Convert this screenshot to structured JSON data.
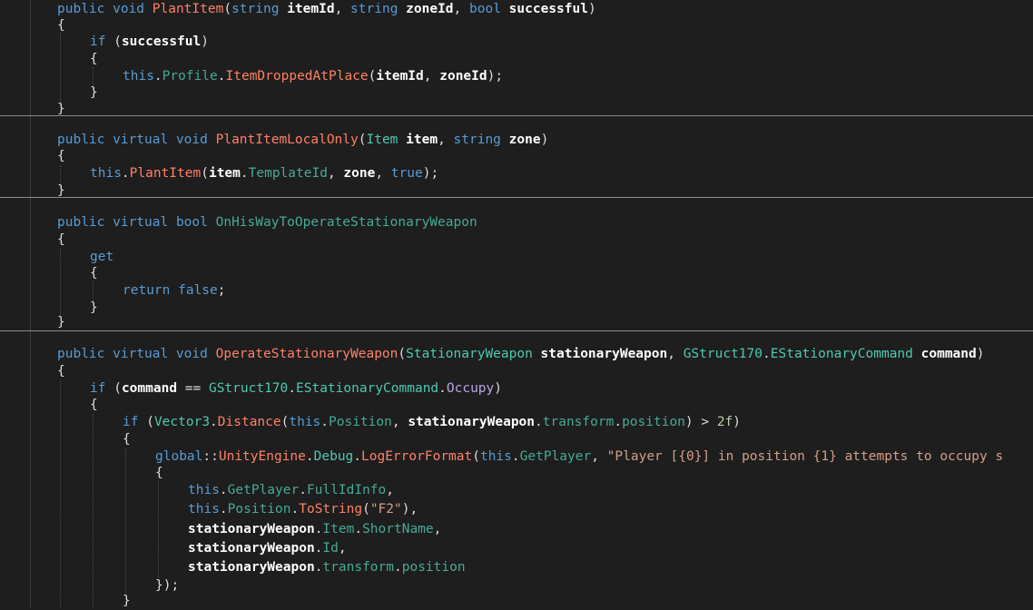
{
  "editor": {
    "theme": "dark",
    "colors": {
      "background": "#1e1e1e",
      "keyword": "#569cd6",
      "method": "#ff8066",
      "type": "#4ec9b0",
      "parameter": "#ffffff",
      "string": "#d69d85",
      "number": "#b5cea8",
      "enum_member": "#b8a7e8",
      "plain": "#dcdcdc"
    }
  },
  "lines": [
    {
      "id": "l1",
      "tokens": [
        [
          "kw",
          "public "
        ],
        [
          "kw",
          "void "
        ],
        [
          "method",
          "PlantItem"
        ],
        [
          "plain",
          "("
        ],
        [
          "kw",
          "string "
        ],
        [
          "param",
          "itemId"
        ],
        [
          "plain",
          ", "
        ],
        [
          "kw",
          "string "
        ],
        [
          "param",
          "zoneId"
        ],
        [
          "plain",
          ", "
        ],
        [
          "kw",
          "bool "
        ],
        [
          "param",
          "successful"
        ],
        [
          "plain",
          ")"
        ]
      ]
    },
    {
      "id": "l2",
      "tokens": [
        [
          "plain",
          "{"
        ]
      ]
    },
    {
      "id": "l3",
      "tokens": [
        [
          "kw",
          "if "
        ],
        [
          "plain",
          "("
        ],
        [
          "param",
          "successful"
        ],
        [
          "plain",
          ")"
        ]
      ]
    },
    {
      "id": "l4",
      "tokens": [
        [
          "plain",
          "{"
        ]
      ]
    },
    {
      "id": "l5",
      "tokens": [
        [
          "kw",
          "this"
        ],
        [
          "plain",
          "."
        ],
        [
          "prop",
          "Profile"
        ],
        [
          "plain",
          "."
        ],
        [
          "method",
          "ItemDroppedAtPlace"
        ],
        [
          "plain",
          "("
        ],
        [
          "param",
          "itemId"
        ],
        [
          "plain",
          ", "
        ],
        [
          "param",
          "zoneId"
        ],
        [
          "plain",
          ");"
        ]
      ]
    },
    {
      "id": "l6",
      "tokens": [
        [
          "plain",
          "}"
        ]
      ]
    },
    {
      "id": "l7",
      "tokens": [
        [
          "plain",
          "}"
        ]
      ]
    },
    {
      "id": "l8",
      "tokens": [
        [
          "kw",
          "public "
        ],
        [
          "kw",
          "virtual "
        ],
        [
          "kw",
          "void "
        ],
        [
          "method",
          "PlantItemLocalOnly"
        ],
        [
          "plain",
          "("
        ],
        [
          "type",
          "Item "
        ],
        [
          "param",
          "item"
        ],
        [
          "plain",
          ", "
        ],
        [
          "kw",
          "string "
        ],
        [
          "param",
          "zone"
        ],
        [
          "plain",
          ")"
        ]
      ]
    },
    {
      "id": "l9",
      "tokens": [
        [
          "plain",
          "{"
        ]
      ]
    },
    {
      "id": "l10",
      "tokens": [
        [
          "kw",
          "this"
        ],
        [
          "plain",
          "."
        ],
        [
          "method",
          "PlantItem"
        ],
        [
          "plain",
          "("
        ],
        [
          "param",
          "item"
        ],
        [
          "plain",
          "."
        ],
        [
          "prop",
          "TemplateId"
        ],
        [
          "plain",
          ", "
        ],
        [
          "param",
          "zone"
        ],
        [
          "plain",
          ", "
        ],
        [
          "kw",
          "true"
        ],
        [
          "plain",
          ");"
        ]
      ]
    },
    {
      "id": "l11",
      "tokens": [
        [
          "plain",
          "}"
        ]
      ]
    },
    {
      "id": "l12",
      "tokens": [
        [
          "kw",
          "public "
        ],
        [
          "kw",
          "virtual "
        ],
        [
          "kw",
          "bool "
        ],
        [
          "prop",
          "OnHisWayToOperateStationaryWeapon"
        ]
      ]
    },
    {
      "id": "l13",
      "tokens": [
        [
          "plain",
          "{"
        ]
      ]
    },
    {
      "id": "l14",
      "tokens": [
        [
          "kw",
          "get"
        ]
      ]
    },
    {
      "id": "l15",
      "tokens": [
        [
          "plain",
          "{"
        ]
      ]
    },
    {
      "id": "l16",
      "tokens": [
        [
          "kw",
          "return "
        ],
        [
          "kw",
          "false"
        ],
        [
          "plain",
          ";"
        ]
      ]
    },
    {
      "id": "l17",
      "tokens": [
        [
          "plain",
          "}"
        ]
      ]
    },
    {
      "id": "l18",
      "tokens": [
        [
          "plain",
          "}"
        ]
      ]
    },
    {
      "id": "l19",
      "tokens": [
        [
          "kw",
          "public "
        ],
        [
          "kw",
          "virtual "
        ],
        [
          "kw",
          "void "
        ],
        [
          "method",
          "OperateStationaryWeapon"
        ],
        [
          "plain",
          "("
        ],
        [
          "type",
          "StationaryWeapon "
        ],
        [
          "param",
          "stationaryWeapon"
        ],
        [
          "plain",
          ", "
        ],
        [
          "type",
          "GStruct170"
        ],
        [
          "plain",
          "."
        ],
        [
          "type",
          "EStationaryCommand "
        ],
        [
          "param",
          "command"
        ],
        [
          "plain",
          ")"
        ]
      ]
    },
    {
      "id": "l20",
      "tokens": [
        [
          "plain",
          "{"
        ]
      ]
    },
    {
      "id": "l21",
      "tokens": [
        [
          "kw",
          "if "
        ],
        [
          "plain",
          "("
        ],
        [
          "param",
          "command"
        ],
        [
          "plain",
          " == "
        ],
        [
          "type",
          "GStruct170"
        ],
        [
          "plain",
          "."
        ],
        [
          "type",
          "EStationaryCommand"
        ],
        [
          "plain",
          "."
        ],
        [
          "enumv",
          "Occupy"
        ],
        [
          "plain",
          ")"
        ]
      ]
    },
    {
      "id": "l22",
      "tokens": [
        [
          "plain",
          "{"
        ]
      ]
    },
    {
      "id": "l23",
      "tokens": [
        [
          "kw",
          "if "
        ],
        [
          "plain",
          "("
        ],
        [
          "type",
          "Vector3"
        ],
        [
          "plain",
          "."
        ],
        [
          "method",
          "Distance"
        ],
        [
          "plain",
          "("
        ],
        [
          "kw",
          "this"
        ],
        [
          "plain",
          "."
        ],
        [
          "prop",
          "Position"
        ],
        [
          "plain",
          ", "
        ],
        [
          "param",
          "stationaryWeapon"
        ],
        [
          "plain",
          "."
        ],
        [
          "prop",
          "transform"
        ],
        [
          "plain",
          "."
        ],
        [
          "prop",
          "position"
        ],
        [
          "plain",
          ") > "
        ],
        [
          "num",
          "2f"
        ],
        [
          "plain",
          ")"
        ]
      ]
    },
    {
      "id": "l24",
      "tokens": [
        [
          "plain",
          "{"
        ]
      ]
    },
    {
      "id": "l25",
      "tokens": [
        [
          "kw",
          "global"
        ],
        [
          "plain",
          "::"
        ],
        [
          "method",
          "UnityEngine"
        ],
        [
          "plain",
          "."
        ],
        [
          "type",
          "Debug"
        ],
        [
          "plain",
          "."
        ],
        [
          "method",
          "LogErrorFormat"
        ],
        [
          "plain",
          "("
        ],
        [
          "kw",
          "this"
        ],
        [
          "plain",
          "."
        ],
        [
          "prop",
          "GetPlayer"
        ],
        [
          "plain",
          ", "
        ],
        [
          "str",
          "\"Player [{0}] in position {1} attempts to occupy s"
        ]
      ]
    },
    {
      "id": "l26",
      "tokens": [
        [
          "plain",
          "{"
        ]
      ]
    },
    {
      "id": "l27",
      "tokens": [
        [
          "kw",
          "this"
        ],
        [
          "plain",
          "."
        ],
        [
          "prop",
          "GetPlayer"
        ],
        [
          "plain",
          "."
        ],
        [
          "prop",
          "FullIdInfo"
        ],
        [
          "plain",
          ","
        ]
      ]
    },
    {
      "id": "l28",
      "tokens": [
        [
          "kw",
          "this"
        ],
        [
          "plain",
          "."
        ],
        [
          "prop",
          "Position"
        ],
        [
          "plain",
          "."
        ],
        [
          "method",
          "ToString"
        ],
        [
          "plain",
          "("
        ],
        [
          "str",
          "\"F2\""
        ],
        [
          "plain",
          "),"
        ]
      ]
    },
    {
      "id": "l29",
      "tokens": [
        [
          "param",
          "stationaryWeapon"
        ],
        [
          "plain",
          "."
        ],
        [
          "prop",
          "Item"
        ],
        [
          "plain",
          "."
        ],
        [
          "prop",
          "ShortName"
        ],
        [
          "plain",
          ","
        ]
      ]
    },
    {
      "id": "l30",
      "tokens": [
        [
          "param",
          "stationaryWeapon"
        ],
        [
          "plain",
          "."
        ],
        [
          "prop",
          "Id"
        ],
        [
          "plain",
          ","
        ]
      ]
    },
    {
      "id": "l31",
      "tokens": [
        [
          "param",
          "stationaryWeapon"
        ],
        [
          "plain",
          "."
        ],
        [
          "prop",
          "transform"
        ],
        [
          "plain",
          "."
        ],
        [
          "prop",
          "position"
        ]
      ]
    },
    {
      "id": "l32",
      "tokens": [
        [
          "plain",
          "});"
        ]
      ]
    },
    {
      "id": "l33",
      "tokens": [
        [
          "plain",
          "}"
        ]
      ]
    }
  ]
}
